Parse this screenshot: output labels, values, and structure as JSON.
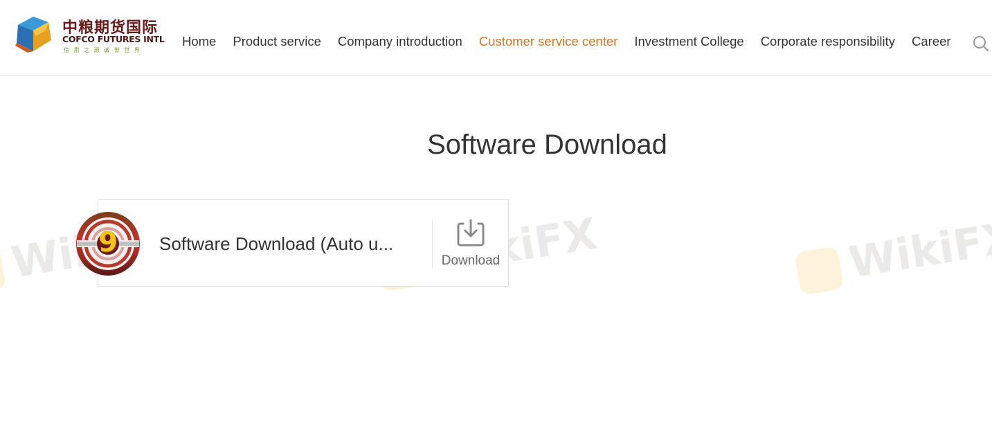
{
  "logo": {
    "cn_name": "中粮期货国际",
    "en_name": "COFCO FUTURES INTL",
    "slogan": "信 用 之 源   诚 誉 世 界"
  },
  "nav": {
    "items": [
      {
        "label": "Home"
      },
      {
        "label": "Product service"
      },
      {
        "label": "Company introduction"
      },
      {
        "label": "Customer service center",
        "active": true
      },
      {
        "label": "Investment College"
      },
      {
        "label": "Corporate responsibility"
      },
      {
        "label": "Career"
      }
    ],
    "search_icon": "search-icon"
  },
  "page": {
    "title": "Software Download"
  },
  "software": {
    "icon": "software-9-logo-icon",
    "icon_text": "9",
    "name": "Software Download (Auto u...",
    "download_label": "Download",
    "download_icon": "download-tray-icon"
  },
  "watermark": {
    "text": "WikiFX"
  },
  "colors": {
    "accent": "#d3762a",
    "text": "#333333",
    "muted": "#666666",
    "border": "#dcdcdc"
  }
}
